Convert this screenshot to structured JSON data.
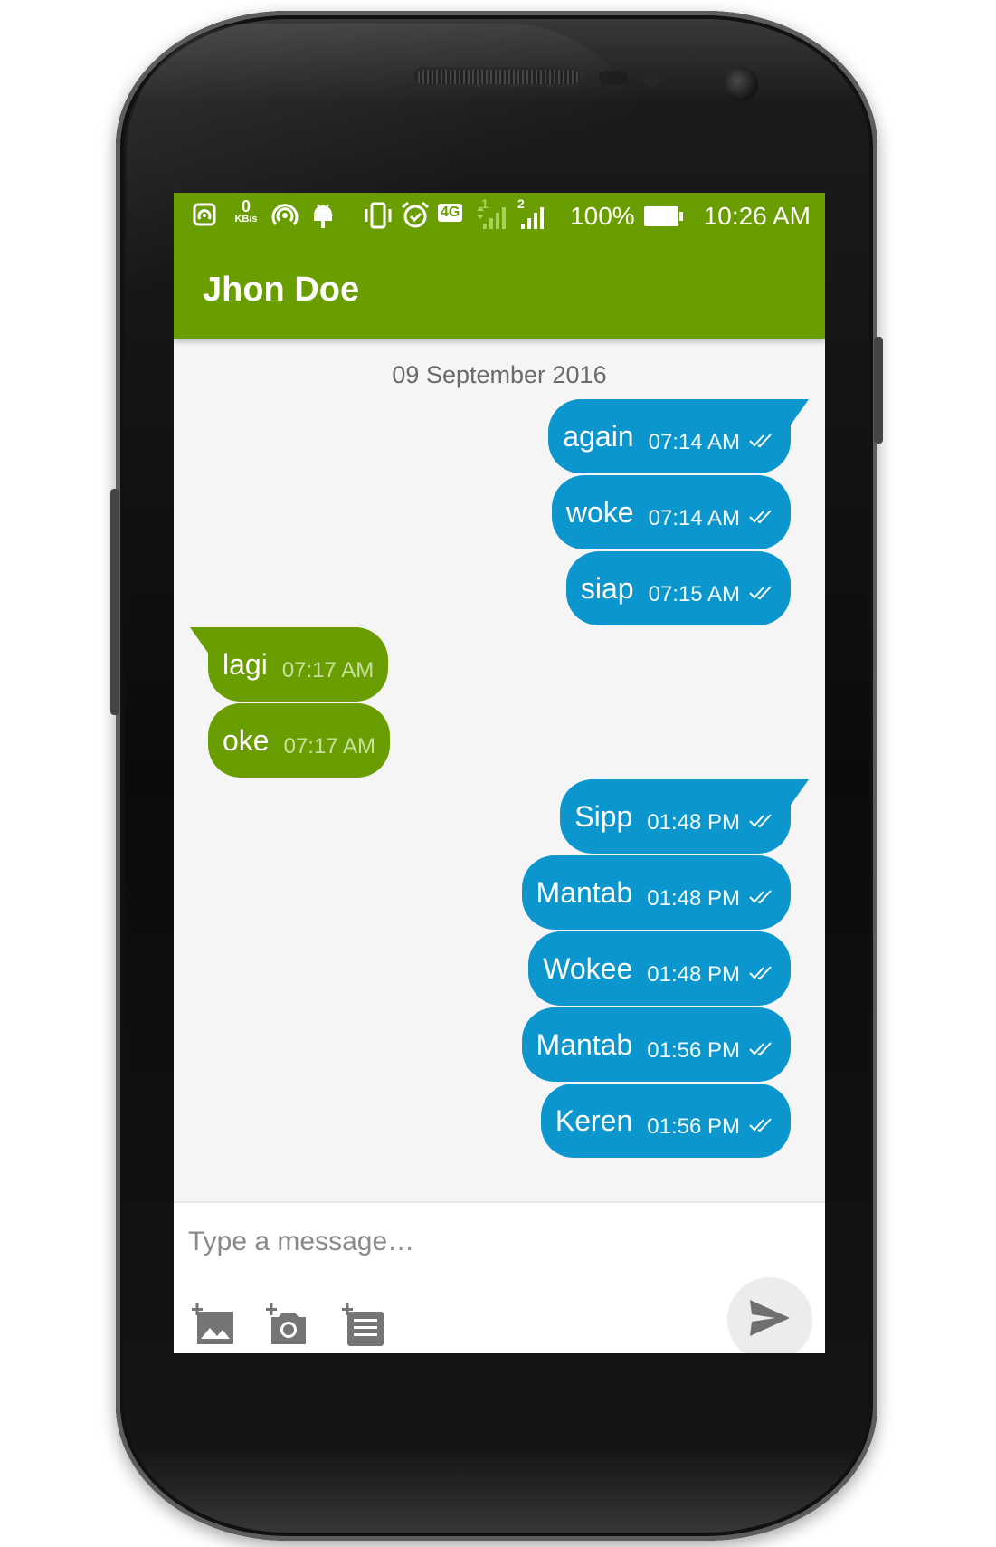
{
  "status_bar": {
    "net_speed_value": "0",
    "net_speed_unit": "KB/s",
    "network_type": "4G",
    "sim1": "1",
    "sim2": "2",
    "battery_percent": "100%",
    "time": "10:26 AM",
    "icons": [
      "nfc-icon",
      "hotspot-icon",
      "android-debug-icon",
      "vibrate-icon",
      "alarm-icon",
      "signal-icon",
      "battery-icon"
    ]
  },
  "app_bar": {
    "title": "Jhon Doe"
  },
  "chat": {
    "date_separator": "09 September 2016",
    "messages": [
      {
        "text": "again",
        "time": "07:14 AM",
        "direction": "out"
      },
      {
        "text": "woke",
        "time": "07:14 AM",
        "direction": "out"
      },
      {
        "text": "siap",
        "time": "07:15 AM",
        "direction": "out"
      },
      {
        "text": "lagi",
        "time": "07:17 AM",
        "direction": "in"
      },
      {
        "text": "oke",
        "time": "07:17 AM",
        "direction": "in"
      },
      {
        "text": "Sipp",
        "time": "01:48 PM",
        "direction": "out"
      },
      {
        "text": "Mantab",
        "time": "01:48 PM",
        "direction": "out"
      },
      {
        "text": "Wokee",
        "time": "01:48 PM",
        "direction": "out"
      },
      {
        "text": "Mantab",
        "time": "01:56 PM",
        "direction": "out"
      },
      {
        "text": "Keren",
        "time": "01:56 PM",
        "direction": "out"
      }
    ]
  },
  "composer": {
    "placeholder": "Type a message…",
    "value": "",
    "attach_icons": [
      "add-image-icon",
      "add-camera-icon",
      "add-list-icon"
    ],
    "send_icon": "send-icon"
  },
  "colors": {
    "primary_green": "#6a9d00",
    "outgoing_bubble": "#0b96cd",
    "chat_background": "#f5f5f5"
  }
}
